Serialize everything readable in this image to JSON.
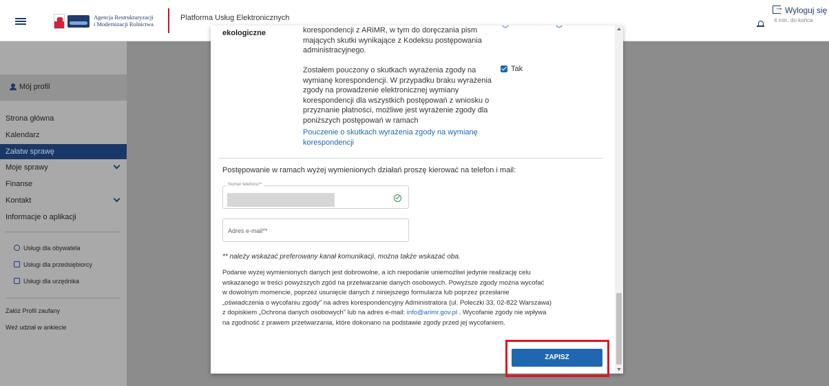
{
  "header": {
    "agency_line1": "Agencja Restrukturyzacji",
    "agency_line2": "i Modernizacji Rolnictwa",
    "platform": "Platforma Usług Elektronicznych",
    "logout": "Wyloguj się",
    "session_remaining": "4 min. do końca"
  },
  "sidebar": {
    "profile": "Mój profil",
    "items": [
      {
        "label": "Strona główna"
      },
      {
        "label": "Kalendarz"
      },
      {
        "label": "Załatw sprawę",
        "active": true
      },
      {
        "label": "Moje sprawy",
        "expandable": true
      },
      {
        "label": "Finanse"
      },
      {
        "label": "Kontakt",
        "expandable": true
      },
      {
        "label": "Informacje o aplikacji"
      }
    ],
    "services": [
      {
        "label": "Usługi dla obywatela",
        "icon": "person-icon"
      },
      {
        "label": "Usługi dla przedsiębiorcy",
        "icon": "briefcase-icon"
      },
      {
        "label": "Usługi dla urzędnika",
        "icon": "monitor-icon"
      }
    ],
    "extras": [
      {
        "label": "Załóż Profil zaufany"
      },
      {
        "label": "Weź udział w ankiecie"
      }
    ]
  },
  "modal": {
    "row_label": "ekologiczne",
    "consent_intro": [
      "korespondencji z ARiMR, w tym do doręczania pism",
      "mających skutki wynikające z Kodeksu postępowania",
      "administracyjnego."
    ],
    "consent_text": [
      "Zostałem pouczony o skutkach wyrażenia zgody na",
      "wymianę korespondencji. W przypadku braku wyrażenia",
      "zgody na prowadzenie elektronicznej wymiany",
      "korespondencji dla wszystkich postępowań z wniosku o",
      "przyznanie płatności, możliwe jest wyrażenie zgody dla",
      "poniższych postępowań w ramach"
    ],
    "checkbox_label": "Tak",
    "checkbox_checked": true,
    "link_lines": [
      "Pouczenie o skutkach wyrażenia zgody na wymianę",
      "korespondencji"
    ],
    "contact_heading": "Postępowanie w ramach wyżej wymienionych działań proszę kierować na telefon i mail:",
    "phone_label": "Numer telefonu**",
    "email_placeholder": "Adres e-mail**",
    "note": "** należy wskazać preferowany kanał komunikacji, można także wskazać oba.",
    "privacy_lines": [
      "Podanie wyżej wymienionych danych jest dobrowolne, a ich niepodanie uniemożliwi jedynie realizację celu",
      "wskazanego w treści powyższych zgód na przetwarzanie danych osobowych. Powyższe zgody można wycofać",
      "w dowolnym momencie, poprzez usunięcie danych z niniejszego formularza lub poprzez przesłanie",
      "„oświadczenia o wycofaniu zgody” na adres korespondencyjny Administratora (ul. Poleczki 33, 02-822 Warszawa)",
      "z dopiskiem „Ochrona danych osobowych” lub na adres e-mail:"
    ],
    "privacy_email": "info@arimr.gov.pl",
    "privacy_tail": " . Wycofanie zgody nie wpływa",
    "privacy_last": "na zgodność z prawem przetwarzania, które dokonano na podstawie zgody przed jej wycofaniem.",
    "submit_label": "ZAPISZ"
  },
  "colors": {
    "accent": "#1f67b1",
    "nav_active": "#1a3867",
    "highlight": "#e3131f"
  }
}
